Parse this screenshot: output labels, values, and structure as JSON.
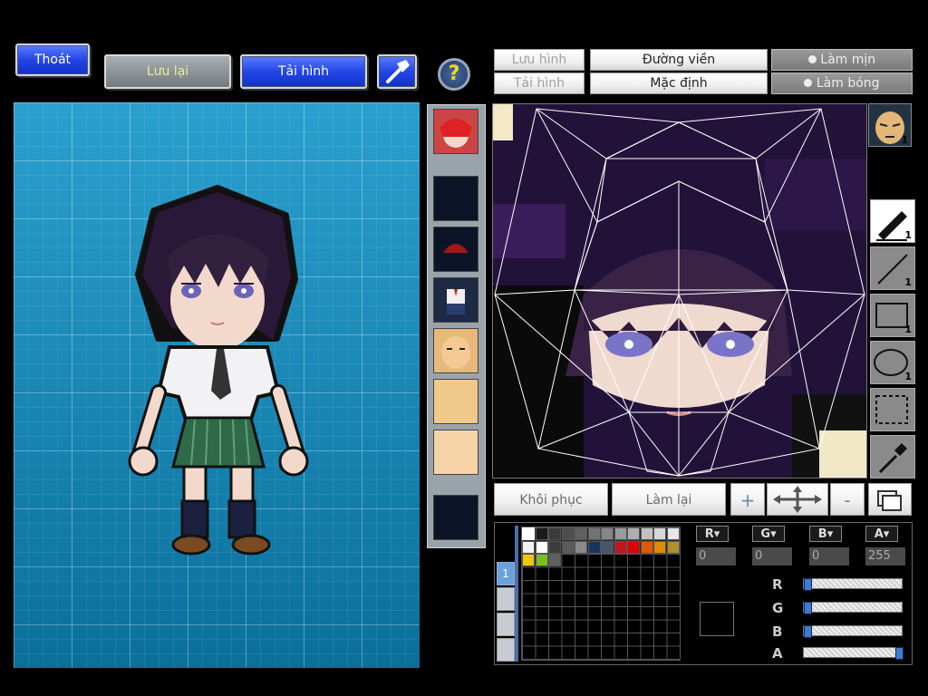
{
  "toolbar": {
    "exit_label": "Thoát",
    "save_label": "Lưu lại",
    "load_label": "Tải hình",
    "help_symbol": "?"
  },
  "editor_toolbar": {
    "save_image_label": "Lưu hình",
    "load_image_label": "Tải hình",
    "outline_label": "Đường viền",
    "default_label": "Mặc định",
    "smooth_label": "Làm mịn",
    "shade_label": "Làm bóng"
  },
  "tools": {
    "pen_count": "1",
    "line_count": "1",
    "rect_count": "1",
    "ellipse_count": "1"
  },
  "preview_badge": "1",
  "actions": {
    "restore_label": "Khôi phục",
    "redo_label": "Làm lại",
    "zoom_in_symbol": "+",
    "zoom_out_symbol": "-"
  },
  "color": {
    "r_label": "R",
    "g_label": "G",
    "b_label": "B",
    "a_label": "A",
    "r_value": "0",
    "g_value": "0",
    "b_value": "0",
    "a_value": "255",
    "r_level": 0.0,
    "g_level": 0.0,
    "b_level": 0.0,
    "a_level": 1.0,
    "layer_tab": "1",
    "palette_row1": [
      "#ffffff",
      "#1a1a1a",
      "#3a3a3a",
      "#4e4e4e",
      "#606060",
      "#737373",
      "#868686",
      "#9a9a9a",
      "#aeaeae",
      "#c2c2c2",
      "#d6d6d6",
      "#e6e6e6"
    ],
    "palette_row2": [
      "#f2f2f2",
      "#ffffff",
      "#3c3c3c",
      "#5c5c5c",
      "#8a8a8a",
      "#1b3466",
      "#48566b",
      "#c01818",
      "#e00000",
      "#e05a00",
      "#e08a00",
      "#b0902a"
    ],
    "palette_row3": [
      "#f0c800",
      "#7ac01a",
      "#606060"
    ]
  }
}
